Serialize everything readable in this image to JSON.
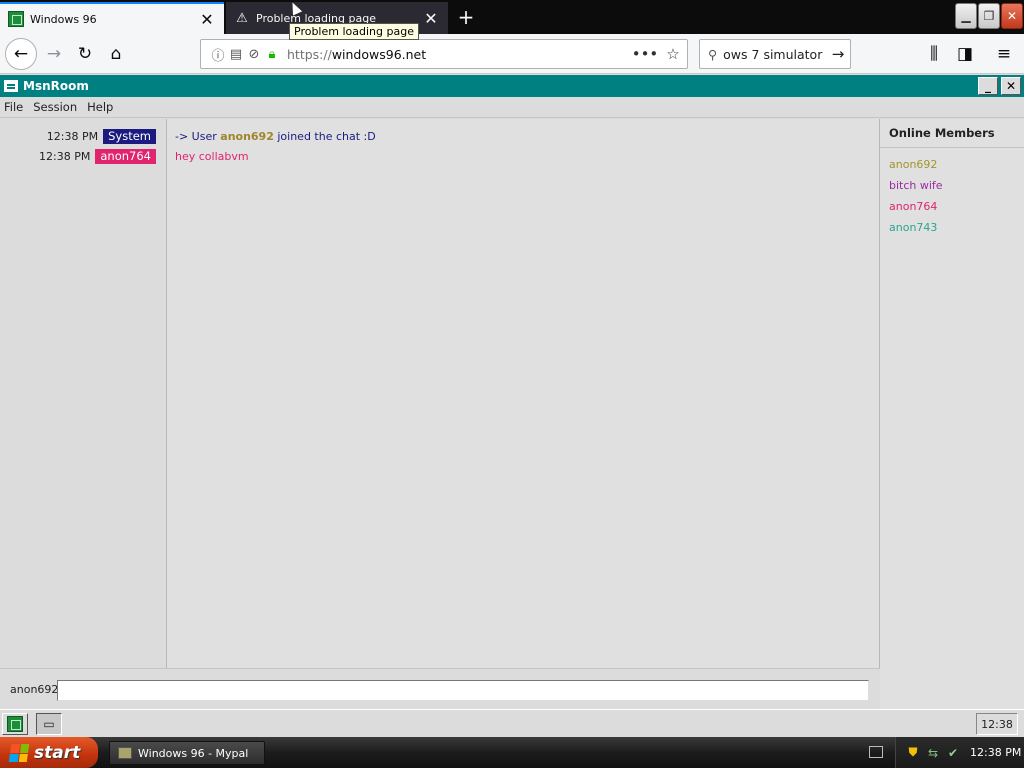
{
  "browser": {
    "tabs": [
      {
        "title": "Windows 96",
        "active": true
      },
      {
        "title": "Problem loading page",
        "active": false
      }
    ],
    "tooltip": "Problem loading page",
    "url": {
      "scheme": "https://",
      "host": "windows96.net"
    },
    "search_query": "ows 7 simulator"
  },
  "app": {
    "title": "MsnRoom",
    "menu": [
      "File",
      "Session",
      "Help"
    ],
    "messages": [
      {
        "time": "12:38 PM",
        "nick": "System",
        "nick_color": "#1a1a80",
        "parts": {
          "prefix": "-> User ",
          "user": "anon692",
          "suffix": " joined the chat :D"
        },
        "prefix_color": "#1a1a80",
        "user_color": "#a0852a"
      },
      {
        "time": "12:38 PM",
        "nick": "anon764",
        "nick_color": "#e0246e",
        "text": "hey collabvm",
        "text_color": "#e0246e"
      }
    ],
    "members_title": "Online Members",
    "members": [
      {
        "name": "anon692",
        "color": "#a0952a"
      },
      {
        "name": "bitch wife",
        "color": "#9b2aa5"
      },
      {
        "name": "anon764",
        "color": "#e0246e"
      },
      {
        "name": "anon743",
        "color": "#2aa58e"
      }
    ],
    "current_user": "anon692",
    "chat_input_value": ""
  },
  "w96_taskbar": {
    "clock": "12:38"
  },
  "xp_taskbar": {
    "start_label": "start",
    "task": "Windows 96 - Mypal",
    "clock": "12:38 PM"
  },
  "colors": {
    "teal": "#008080",
    "firefox_accent": "#0a84ff"
  }
}
